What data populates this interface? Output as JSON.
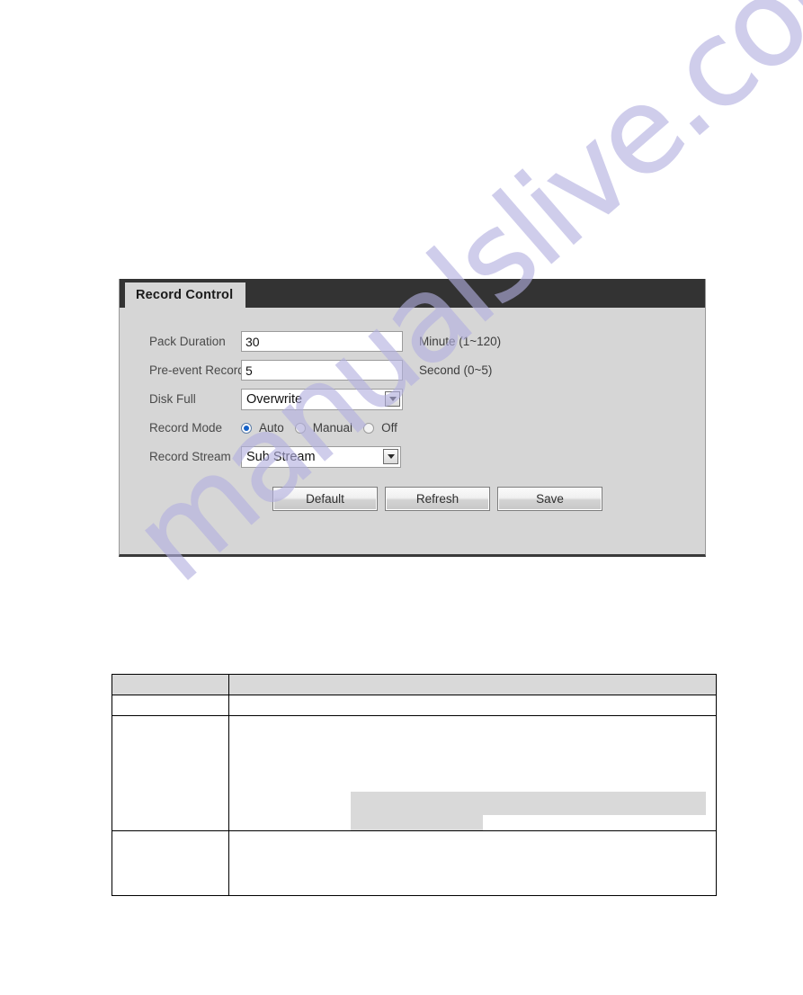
{
  "panel": {
    "tab_label": "Record Control",
    "rows": [
      {
        "label": "Pack Duration",
        "type": "text",
        "value": "30",
        "hint": "Minute (1~120)"
      },
      {
        "label": "Pre-event Record",
        "type": "text",
        "value": "5",
        "hint": "Second (0~5)"
      },
      {
        "label": "Disk Full",
        "type": "select",
        "value": "Overwrite",
        "arrow_icon": "chevron-down-icon"
      },
      {
        "label": "Record Mode",
        "type": "radio",
        "options": [
          {
            "label": "Auto",
            "selected": true
          },
          {
            "label": "Manual",
            "selected": false
          },
          {
            "label": "Off",
            "selected": false
          }
        ]
      },
      {
        "label": "Record Stream",
        "type": "select",
        "value": "Sub Stream",
        "arrow_icon": "chevron-down-icon"
      }
    ],
    "buttons": [
      {
        "label": "Default"
      },
      {
        "label": "Refresh"
      },
      {
        "label": "Save"
      }
    ]
  },
  "table": {
    "rows": [
      {
        "kind": "header",
        "cells": [
          "",
          ""
        ]
      },
      {
        "kind": "sub",
        "cells": [
          "",
          ""
        ]
      },
      {
        "kind": "big",
        "cells": [
          "",
          ""
        ]
      },
      {
        "kind": "last",
        "cells": [
          "",
          ""
        ]
      }
    ]
  },
  "watermark": {
    "text": "manualslive.com",
    "color": "#b3b0e0"
  }
}
